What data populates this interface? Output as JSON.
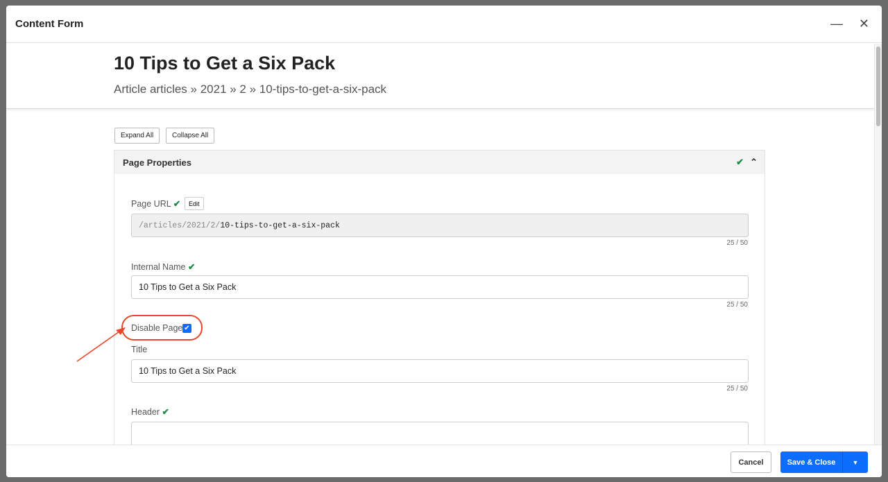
{
  "modal": {
    "title": "Content Form",
    "minimize_icon": "minus-icon",
    "close_icon": "close-icon"
  },
  "page": {
    "title": "10 Tips to Get a Six Pack",
    "breadcrumb": "Article articles » 2021 » 2 » 10-tips-to-get-a-six-pack"
  },
  "toolbar": {
    "expand_all": "Expand All",
    "collapse_all": "Collapse All"
  },
  "section": {
    "title": "Page Properties"
  },
  "fields": {
    "page_url": {
      "label": "Page URL",
      "edit": "Edit",
      "prefix": "/articles/2021/2/",
      "slug": "10-tips-to-get-a-six-pack",
      "count": "25 / 50"
    },
    "internal_name": {
      "label": "Internal Name",
      "value": "10 Tips to Get a Six Pack",
      "count": "25 / 50"
    },
    "disable_page": {
      "label": "Disable Page",
      "checked": true
    },
    "title": {
      "label": "Title",
      "value": "10 Tips to Get a Six Pack",
      "count": "25 / 50"
    },
    "header": {
      "label": "Header",
      "value": ""
    }
  },
  "footer": {
    "cancel": "Cancel",
    "save_close": "Save & Close"
  },
  "colors": {
    "primary": "#0d6efd",
    "valid": "#1e8a45",
    "annotation": "#e8462a"
  }
}
